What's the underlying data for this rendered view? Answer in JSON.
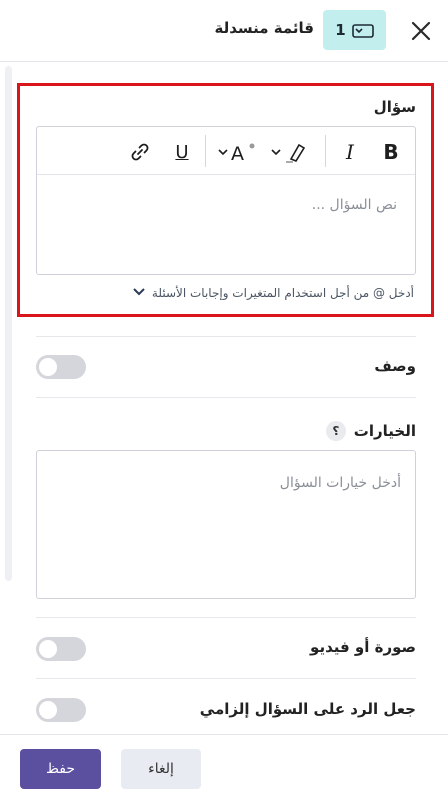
{
  "header": {
    "title": "قائمة منسدلة",
    "badge_number": "1",
    "close_icon": "close-icon",
    "badge_icon": "dropdown-list-icon"
  },
  "question": {
    "label": "سؤال",
    "placeholder": "نص السؤال ...",
    "toolbar": {
      "bold": "B",
      "italic": "I",
      "underline": "U",
      "color": "A",
      "icons": [
        "bold-icon",
        "italic-icon",
        "highlighter-icon",
        "font-color-icon",
        "underline-icon",
        "link-icon"
      ]
    },
    "hint": "أدخل @ من أجل استخدام المتغيرات وإجابات الأسئلة"
  },
  "description": {
    "label": "وصف",
    "enabled": false
  },
  "choices": {
    "label": "الخيارات",
    "help": "؟",
    "placeholder": "أدخل خيارات السؤال"
  },
  "media": {
    "label": "صورة أو فيديو",
    "enabled": false
  },
  "required": {
    "label": "جعل الرد على السؤال إلزامي",
    "enabled": false
  },
  "footer": {
    "save_label": "حفظ",
    "cancel_label": "إلغاء"
  },
  "colors": {
    "accent": "#5b50a0",
    "badge_bg": "#c3eeee",
    "highlight_border": "#d9141a",
    "toggle_off": "#d4d6db"
  }
}
